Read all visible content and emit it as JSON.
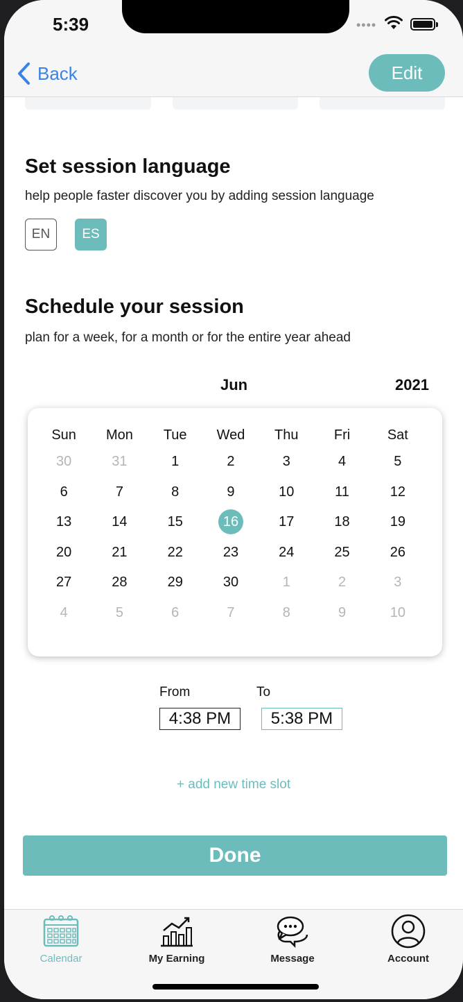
{
  "status": {
    "time": "5:39"
  },
  "nav": {
    "back_label": "Back",
    "edit_label": "Edit"
  },
  "language": {
    "title": "Set session language",
    "subtitle": "help people faster discover you by adding session language",
    "options": [
      {
        "code": "EN",
        "selected": false
      },
      {
        "code": "ES",
        "selected": true
      }
    ]
  },
  "schedule": {
    "title": "Schedule your session",
    "subtitle": "plan for a week, for a month or for the entire year ahead",
    "month": "Jun",
    "year": "2021",
    "weekdays": [
      "Sun",
      "Mon",
      "Tue",
      "Wed",
      "Thu",
      "Fri",
      "Sat"
    ],
    "weeks": [
      [
        "30",
        "31",
        "1",
        "2",
        "3",
        "4",
        "5"
      ],
      [
        "6",
        "7",
        "8",
        "9",
        "10",
        "11",
        "12"
      ],
      [
        "13",
        "14",
        "15",
        "16",
        "17",
        "18",
        "19"
      ],
      [
        "20",
        "21",
        "22",
        "23",
        "24",
        "25",
        "26"
      ],
      [
        "27",
        "28",
        "29",
        "30",
        "1",
        "2",
        "3"
      ],
      [
        "4",
        "5",
        "6",
        "7",
        "8",
        "9",
        "10"
      ]
    ],
    "selected_day": "16",
    "from_label": "From",
    "to_label": "To",
    "from_time": "4:38 PM",
    "to_time": "5:38 PM",
    "add_slot_label": "+ add new time slot",
    "done_label": "Done"
  },
  "tabs": [
    {
      "label": "Calendar",
      "icon": "calendar-icon",
      "active": true
    },
    {
      "label": "My Earning",
      "icon": "earning-chart-icon",
      "active": false
    },
    {
      "label": "Message",
      "icon": "message-bubbles-icon",
      "active": false
    },
    {
      "label": "Account",
      "icon": "account-icon",
      "active": false
    }
  ],
  "colors": {
    "accent": "#6dbcbc",
    "link": "#3b82e8",
    "muted_day": "#b5b5b5"
  }
}
